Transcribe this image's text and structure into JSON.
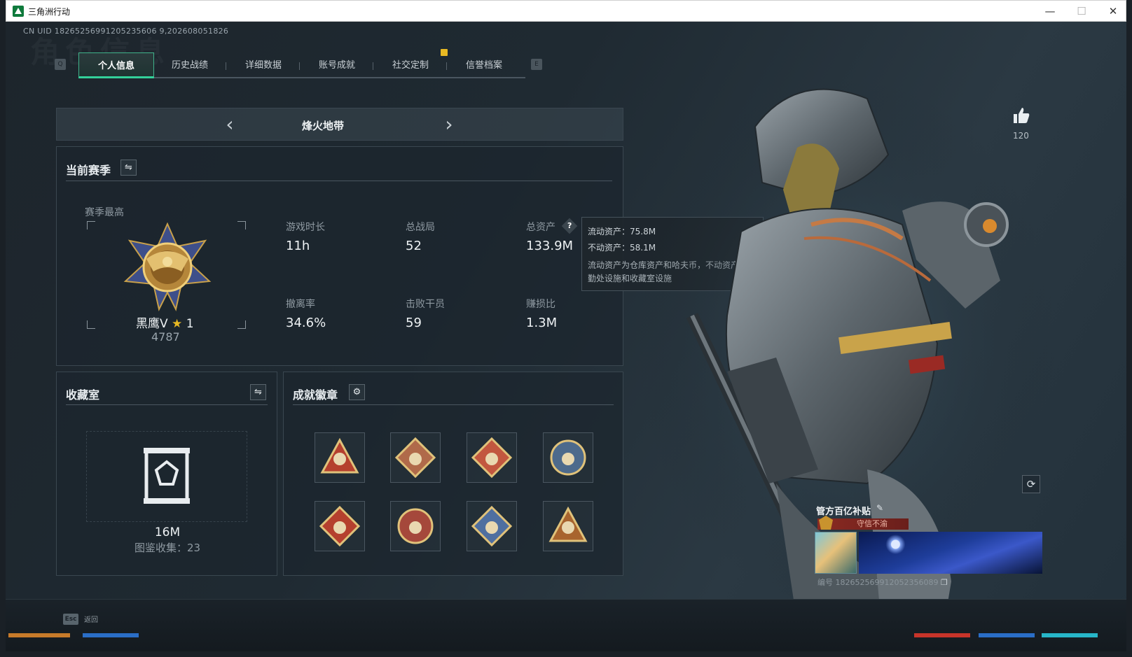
{
  "window": {
    "title": "三角洲行动",
    "min_label": "—",
    "max_label": "☐",
    "close_label": "✕"
  },
  "uid_text": "CN UID 18265256991205235606 9,202608051826",
  "bg_watermark": "角色信息",
  "tabs": {
    "left_key": "Q",
    "right_key": "E",
    "items": [
      {
        "label": "个人信息",
        "active": true
      },
      {
        "label": "历史战绩",
        "active": false
      },
      {
        "label": "详细数据",
        "active": false
      },
      {
        "label": "账号成就",
        "active": false
      },
      {
        "label": "社交定制",
        "active": false
      },
      {
        "label": "信誉档案",
        "active": false
      }
    ]
  },
  "map_selector": {
    "prev": "‹",
    "next": "›",
    "name": "烽火地带"
  },
  "season": {
    "title": "当前赛季",
    "best_label": "赛季最高",
    "rank_name": "黑鹰V",
    "rank_stars": "1",
    "rank_points": "4787",
    "stats": [
      {
        "label": "游戏时长",
        "value": "11h"
      },
      {
        "label": "总战局",
        "value": "52"
      },
      {
        "label": "总资产",
        "value": "133.9M"
      },
      {
        "label": "撤离率",
        "value": "34.6%"
      },
      {
        "label": "击败干员",
        "value": "59"
      },
      {
        "label": "赚损比",
        "value": "1.3M"
      }
    ]
  },
  "tooltip": {
    "liquid": "流动资产：75.8M",
    "fixed": "不动资产：58.1M",
    "desc": "流动资产为仓库资产和哈夫币，不动资产为特勤处设施和收藏室设施"
  },
  "collection": {
    "title": "收藏室",
    "value": "16M",
    "catalog": "图鉴收集：23"
  },
  "achievements": {
    "title": "成就徽章",
    "badges": [
      {
        "icon": "triangle-eye-badge-icon",
        "color": "#b5402e"
      },
      {
        "icon": "wolf-badge-icon",
        "color": "#b06a4a"
      },
      {
        "icon": "wolf-badge-icon",
        "color": "#c2573f"
      },
      {
        "icon": "shield-badge-icon",
        "color": "#4d6a8c"
      },
      {
        "icon": "wolf-badge-icon",
        "color": "#b5402e"
      },
      {
        "icon": "star-badge-icon",
        "color": "#a5483b"
      },
      {
        "icon": "wolf-badge-icon",
        "color": "#4f6fa0"
      },
      {
        "icon": "triangle-badge-icon",
        "color": "#a8642e"
      }
    ]
  },
  "likes": {
    "count": "120"
  },
  "profile_card": {
    "title": "管方百亿补贴",
    "edit": "✎",
    "tag": "守信不渝",
    "id_text": "编号 182652569912052356089"
  },
  "footer": {
    "esc_key": "Esc",
    "back_label": "返回"
  }
}
